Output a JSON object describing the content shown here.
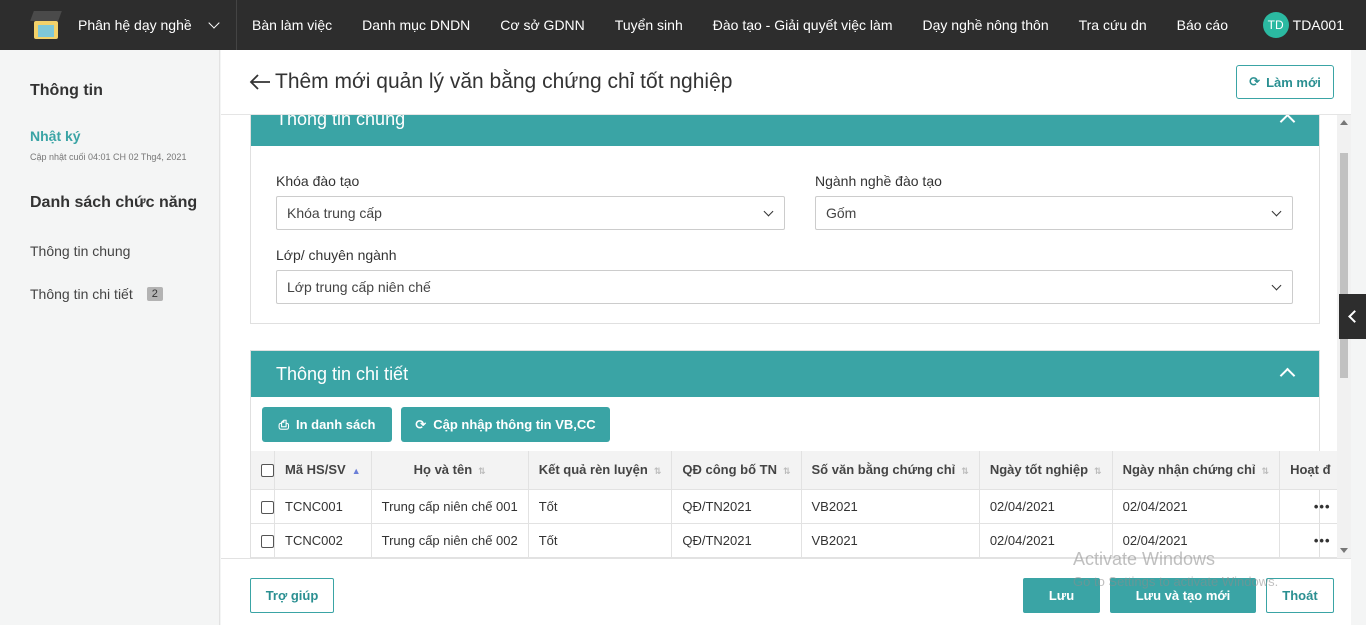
{
  "topbar": {
    "module_label": "Phân hệ dạy nghề",
    "menu": [
      "Bàn làm việc",
      "Danh mục DNDN",
      "Cơ sở GDNN",
      "Tuyển sinh",
      "Đào tạo - Giải quyết việc làm",
      "Dạy nghề nông thôn",
      "Tra cứu dn",
      "Báo cáo"
    ],
    "user_initials": "TD",
    "user_name": "TDA001"
  },
  "sidebar": {
    "info_title": "Thông tin",
    "log_label": "Nhật ký",
    "log_updated": "Cập nhật cuối 04:01 CH 02 Thg4, 2021",
    "functions_title": "Danh sách chức năng",
    "items": [
      {
        "label": "Thông tin chung"
      },
      {
        "label": "Thông tin chi tiết",
        "badge": "2"
      }
    ]
  },
  "header": {
    "title": "Thêm mới quản lý văn bằng chứng chỉ tốt nghiệp",
    "refresh_label": "Làm mới"
  },
  "general": {
    "title": "Thông tin chung",
    "fields": {
      "course_label": "Khóa đào tạo",
      "course_value": "Khóa trung cấp",
      "major_label": "Ngành nghề đào tạo",
      "major_value": "Gốm",
      "class_label": "Lớp/ chuyên ngành",
      "class_value": "Lớp trung cấp niên chế"
    }
  },
  "detail": {
    "title": "Thông tin chi tiết",
    "print_label": "In danh sách",
    "update_label": "Cập nhập thông tin VB,CC",
    "columns": [
      "Mã HS/SV",
      "Họ và tên",
      "Kết quả rèn luyện",
      "QĐ công bố TN",
      "Số văn bằng chứng chỉ",
      "Ngày tốt nghiệp",
      "Ngày nhận chứng chỉ",
      "Hoạt đ"
    ],
    "rows": [
      {
        "code": "TCNC001",
        "name": "Trung cấp niên chế 001",
        "result": "Tốt",
        "decision": "QĐ/TN2021",
        "cert_no": "VB2021",
        "grad_date": "02/04/2021",
        "recv_date": "02/04/2021",
        "action": "•••"
      },
      {
        "code": "TCNC002",
        "name": "Trung cấp niên chế 002",
        "result": "Tốt",
        "decision": "QĐ/TN2021",
        "cert_no": "VB2021",
        "grad_date": "02/04/2021",
        "recv_date": "02/04/2021",
        "action": "•••"
      }
    ]
  },
  "footer": {
    "help_label": "Trợ giúp",
    "save_label": "Lưu",
    "save_new_label": "Lưu và tạo mới",
    "exit_label": "Thoát"
  },
  "watermark": {
    "line1": "Activate Windows",
    "line2": "Go to Settings to activate Windows."
  },
  "colors": {
    "accent": "#3aa4a5",
    "topbar": "#2d2d2d",
    "avatar": "#2bb9a1"
  }
}
